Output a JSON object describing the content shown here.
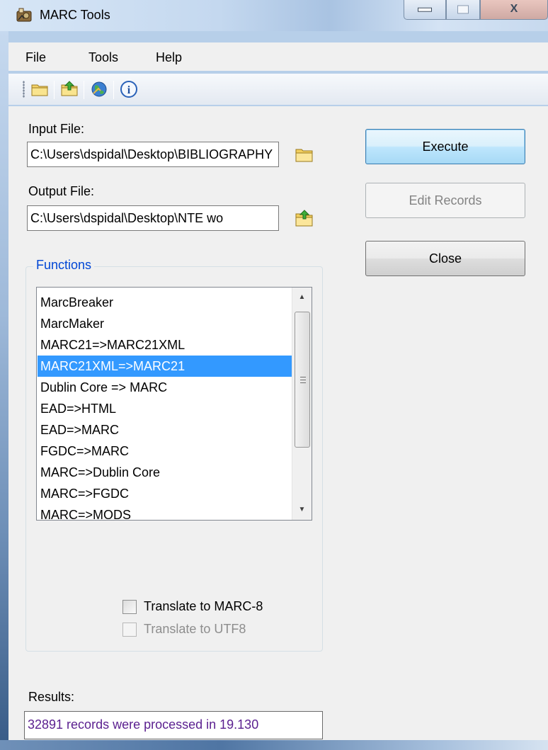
{
  "window": {
    "title": "MARC Tools",
    "min_icon": "minimize-icon",
    "max_icon": "maximize-icon",
    "close_glyph": "X"
  },
  "menu": {
    "items": [
      "File",
      "Tools",
      "Help"
    ]
  },
  "toolbar": {
    "icons": [
      "open-folder-icon",
      "save-folder-icon",
      "web-globe-icon",
      "info-icon"
    ],
    "info_glyph": "i"
  },
  "input_file": {
    "label": "Input File:",
    "value": "C:\\Users\\dspidal\\Desktop\\BIBLIOGRAPHY"
  },
  "output_file": {
    "label": "Output File:",
    "value": "C:\\Users\\dspidal\\Desktop\\NTE wo"
  },
  "buttons": {
    "execute": "Execute",
    "edit_records": "Edit Records",
    "close": "Close"
  },
  "functions": {
    "title": "Functions",
    "items": [
      "MarcBreaker",
      "MarcMaker",
      "MARC21=>MARC21XML",
      "MARC21XML=>MARC21",
      "Dublin Core => MARC",
      "EAD=>HTML",
      "EAD=>MARC",
      "FGDC=>MARC",
      "MARC=>Dublin Core",
      "MARC=>FGDC",
      "MARC=>MODS"
    ],
    "selected": "MARC21XML=>MARC21",
    "scroll_up_glyph": "▲",
    "scroll_down_glyph": "▼"
  },
  "options": {
    "translate_marc8": "Translate to MARC-8",
    "translate_utf8": "Translate to UTF8"
  },
  "results": {
    "label": "Results:",
    "value": "32891 records were processed in 19.130"
  },
  "colors": {
    "selection": "#3399ff",
    "group_title": "#0046d5",
    "results_text": "#5a1f8f"
  }
}
